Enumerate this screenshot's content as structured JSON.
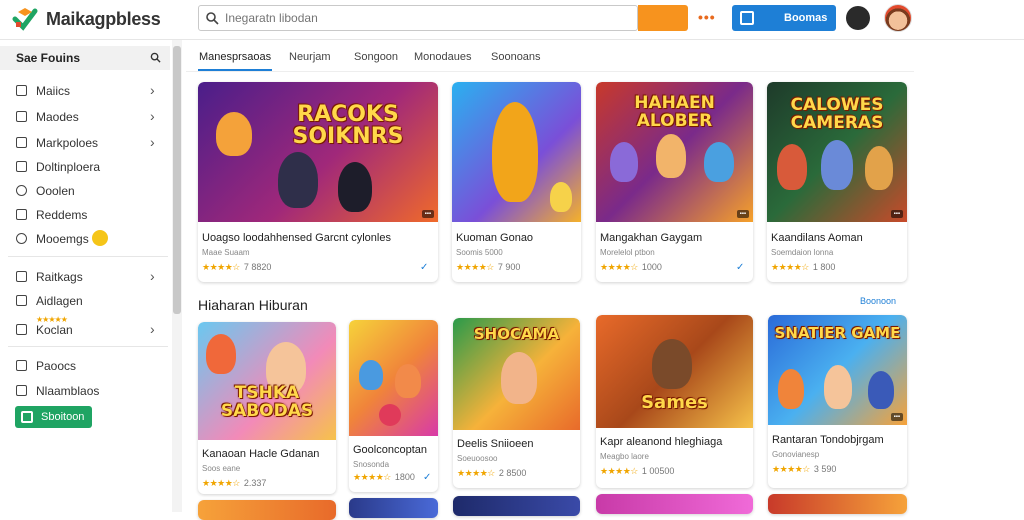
{
  "app": {
    "brand": "Maikagpbless",
    "colors": {
      "accent": "#1e7fd6",
      "search_button": "#f7931e",
      "green": "#1fa463",
      "star": "#f0a500"
    }
  },
  "header": {
    "search_placeholder": "Inegaratn libodan",
    "more_label": "•••",
    "primary_button_label": "Boomas"
  },
  "sidebar": {
    "title": "Sae Fouins",
    "groups": [
      {
        "items": [
          {
            "label": "Maiics",
            "icon": "bag-icon",
            "chevron": true
          },
          {
            "label": "Maodes",
            "icon": "box-icon",
            "chevron": true
          },
          {
            "label": "Markpoloes",
            "icon": "chart-icon",
            "chevron": true
          },
          {
            "label": "Doltinploera",
            "icon": "doc-icon",
            "chevron": false
          },
          {
            "label": "Ooolen",
            "icon": "circle-icon",
            "chevron": false
          },
          {
            "label": "Reddems",
            "icon": "edit-icon",
            "chevron": false
          },
          {
            "label": "Mooemgs",
            "icon": "clock-icon",
            "chevron": false
          }
        ]
      },
      {
        "items": [
          {
            "label": "Raitkags",
            "icon": "box-icon",
            "chevron": true
          },
          {
            "label": "Aidlagen",
            "icon": "doc-icon",
            "chevron": false
          },
          {
            "label": "Koclan",
            "icon": "gift-icon",
            "chevron": true
          }
        ]
      },
      {
        "items": [
          {
            "label": "Paoocs",
            "icon": "square-icon",
            "chevron": false
          },
          {
            "label": "Nlaamblaos",
            "icon": "folder-icon",
            "chevron": false
          }
        ]
      }
    ],
    "green_button_label": "Sboitoon"
  },
  "tabs": [
    "Manesprsaoas",
    "Neurjam",
    "Songoon",
    "Monodaues",
    "Soonoans"
  ],
  "featured": [
    {
      "art": "RACOKS SOIKNRS",
      "title": "Uoagso loodahhensed Garcnt cylonles",
      "sub": "Maae Suaam",
      "rating": "★★★★☆",
      "count": "7 8820",
      "checked": true
    },
    {
      "art": "",
      "title": "Kuoman Gonao",
      "sub": "Soomis 5000",
      "rating": "★★★★☆",
      "count": "7 900",
      "checked": false
    },
    {
      "art": "HAHAEN ALOBER",
      "title": "Mangakhan Gaygam",
      "sub": "Morelelol ptbon",
      "rating": "★★★★☆",
      "count": "1000",
      "checked": true
    },
    {
      "art": "CALOWES CAMERAS",
      "title": "Kaandilans Aoman",
      "sub": "Soemdaion lonna",
      "rating": "★★★★☆",
      "count": "1 800",
      "checked": false
    }
  ],
  "section": {
    "title": "Hiaharan Hiburan",
    "link": "Boonoon"
  },
  "row2": [
    {
      "art": "TSHKA SABODAS",
      "title": "Kanaoan Hacle Gdanan",
      "sub": "Soos eane",
      "rating": "★★★★☆",
      "count": "2.337",
      "checked": false
    },
    {
      "art": "",
      "title": "Goolconcoptan",
      "sub": "Snosonda",
      "rating": "★★★★☆",
      "count": "1800",
      "checked": true
    },
    {
      "art": "SHOCAMA",
      "title": "Deelis Sniioeen",
      "sub": "Soeuoosoo",
      "rating": "★★★★☆",
      "count": "2 8500",
      "checked": false
    },
    {
      "art": "Sames",
      "title": "Kapr aleanond hleghiaga",
      "sub": "Meagbo laore",
      "rating": "★★★★☆",
      "count": "1 00500",
      "checked": false
    },
    {
      "art": "SNATIER GAME",
      "title": "Rantaran Tondobjrgam",
      "sub": "Gonovianesp",
      "rating": "★★★★☆",
      "count": "3 590",
      "checked": false
    }
  ]
}
